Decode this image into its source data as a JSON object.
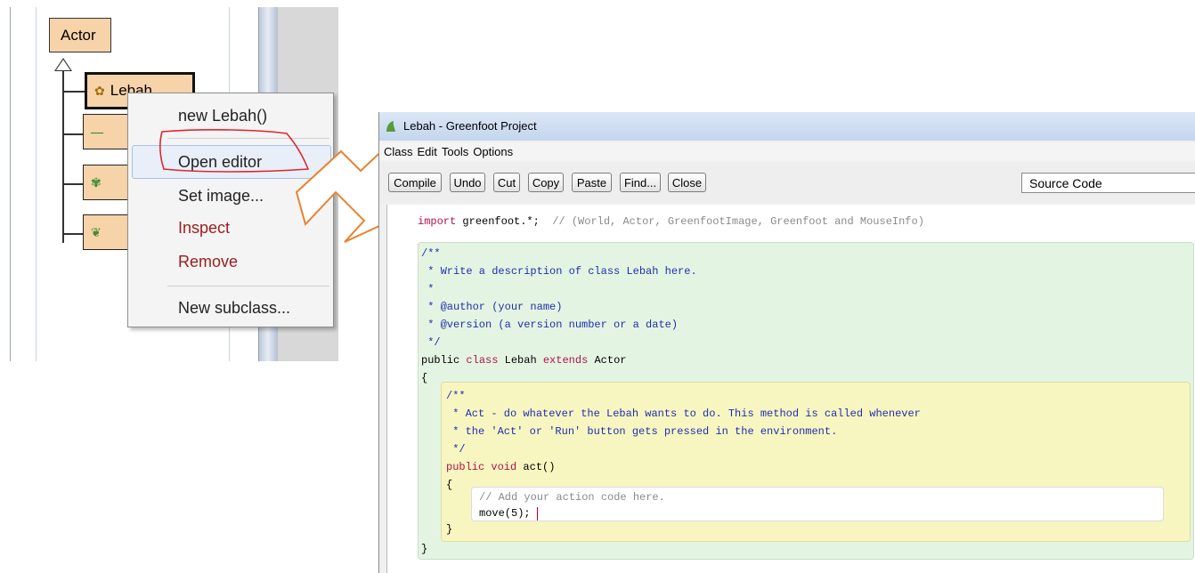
{
  "class_tree": {
    "root_class": "Actor",
    "selected_class": "Lebah"
  },
  "context_menu": {
    "items": [
      "new Lebah()",
      "Open editor",
      "Set image...",
      "Inspect",
      "Remove",
      "New subclass..."
    ]
  },
  "editor": {
    "window_title": "Lebah - Greenfoot Project",
    "menu": [
      "Class",
      "Edit",
      "Tools",
      "Options"
    ],
    "toolbar": [
      "Compile",
      "Undo",
      "Cut",
      "Copy",
      "Paste",
      "Find...",
      "Close"
    ],
    "view_selector": "Source Code",
    "code": {
      "import_kw": "import",
      "import_rest": " greenfoot.*;",
      "import_comment": "  // (World, Actor, GreenfootImage, Greenfoot and MouseInfo)",
      "doc1": "/**",
      "doc2": " * Write a description of class Lebah here.",
      "doc3": " *",
      "doc4": " * @author (your name)",
      "doc5": " * @version (a version number or a date)",
      "doc6": " */",
      "class_public": "public ",
      "class_kw": "class",
      "class_name": " Lebah ",
      "class_extends": "extends",
      "class_parent": " Actor",
      "brace_open": "{",
      "mdoc1": "/**",
      "mdoc2": " * Act - do whatever the Lebah wants to do. This method is called whenever",
      "mdoc3": " * the 'Act' or 'Run' button gets pressed in the environment.",
      "mdoc4": " */",
      "method_kw": "public void",
      "method_name": " act()",
      "mbrace_open": "{",
      "body_comment": "// Add your action code here.",
      "body_stmt": "move(5);",
      "mbrace_close": "}",
      "brace_close": "}"
    }
  }
}
